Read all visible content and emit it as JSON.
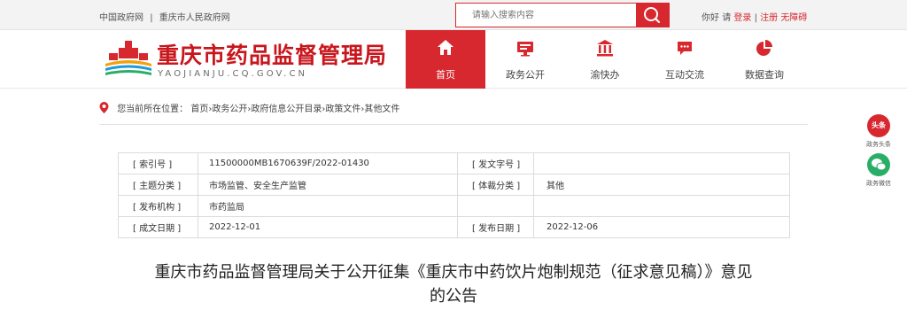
{
  "topbar": {
    "link_gov": "中国政府网",
    "link_sep": "|",
    "link_cq": "重庆市人民政府网",
    "search_placeholder": "请输入搜索内容",
    "greeting": "你好",
    "please": "请",
    "login": "登录",
    "divider": "|",
    "register": "注册",
    "accessibility": "无障碍"
  },
  "brand": {
    "title": "重庆市药品监督管理局",
    "domain": "YAOJIANJU.CQ.GOV.CN"
  },
  "nav": {
    "items": [
      {
        "label": "首页",
        "icon": "home-icon"
      },
      {
        "label": "政务公开",
        "icon": "monitor-icon"
      },
      {
        "label": "渝快办",
        "icon": "bank-icon"
      },
      {
        "label": "互动交流",
        "icon": "chat-icon"
      },
      {
        "label": "数据查询",
        "icon": "pie-chart-icon"
      }
    ]
  },
  "breadcrumb": {
    "prefix": "您当前所在位置：",
    "items": [
      "首页",
      "政务公开",
      "政府信息公开目录",
      "政策文件",
      "其他文件"
    ],
    "sep": "›"
  },
  "meta": {
    "rows": [
      {
        "k1": "[ 索引号 ]",
        "v1": "11500000MB1670639F/2022-01430",
        "k2": "[ 发文字号 ]",
        "v2": ""
      },
      {
        "k1": "[ 主题分类 ]",
        "v1": "市场监管、安全生产监管",
        "k2": "[ 体裁分类 ]",
        "v2": "其他"
      },
      {
        "k1": "[ 发布机构 ]",
        "v1": "市药监局",
        "k2": "",
        "v2": ""
      },
      {
        "k1": "[ 成文日期 ]",
        "v1": "2022-12-01",
        "k2": "[ 发布日期 ]",
        "v2": "2022-12-06"
      }
    ]
  },
  "article": {
    "title_line1": "重庆市药品监督管理局关于公开征集《重庆市中药饮片炮制规范（征求意见稿）》意见",
    "title_line2": "的公告"
  },
  "side": {
    "toutiao_badge": "头条",
    "toutiao_label": "政务头条",
    "wechat_label": "政务微信"
  },
  "colors": {
    "brand_red": "#d7282f",
    "wechat_green": "#2aae67"
  }
}
